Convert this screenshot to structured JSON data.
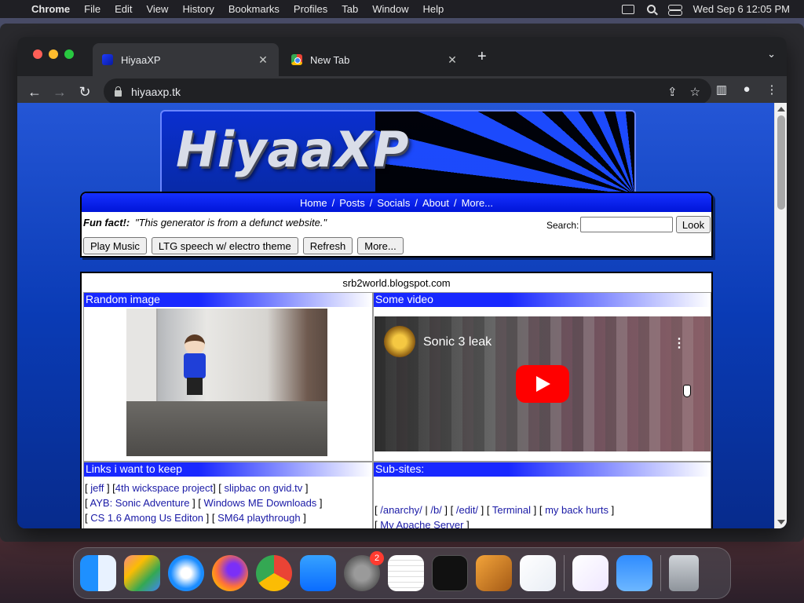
{
  "menubar": {
    "app_name": "Chrome",
    "items": [
      "File",
      "Edit",
      "View",
      "History",
      "Bookmarks",
      "Profiles",
      "Tab",
      "Window",
      "Help"
    ],
    "datetime": "Wed Sep 6  12:05 PM"
  },
  "browser": {
    "tabs": [
      {
        "title": "HiyaaXP",
        "active": true
      },
      {
        "title": "New Tab",
        "active": false
      }
    ],
    "url": "hiyaaxp.tk"
  },
  "page": {
    "banner_text": "HiyaaXP",
    "nav": [
      "Home",
      "Posts",
      "Socials",
      "About",
      "More..."
    ],
    "fun_fact_label": "Fun fact!:",
    "fun_fact_text": "\"This generator is from a defunct website.\"",
    "search_label": "Search:",
    "search_button": "Look",
    "buttons": [
      "Play Music",
      "LTG speech w/ electro theme",
      "Refresh",
      "More..."
    ],
    "site_title": "srb2world.blogspot.com",
    "sections": {
      "random_image": "Random image",
      "some_video": "Some video",
      "links": "Links i want to keep",
      "subsites": "Sub-sites:"
    },
    "video_title": "Sonic 3 leak",
    "links": [
      [
        "jeff",
        "4th wickspace project",
        "slipbac on gvid.tv"
      ],
      [
        "AYB: Sonic Adventure",
        "Windows ME Downloads"
      ],
      [
        "CS 1.6 Among Us Editon",
        "SM64 playthrough"
      ]
    ],
    "subsites": [
      [
        "/anarchy/",
        "/b/",
        "/edit/",
        "Terminal",
        "my back hurts"
      ],
      [
        "My Apache Server"
      ]
    ]
  },
  "dock": {
    "apps": [
      "Finder",
      "Launchpad",
      "Safari",
      "Firefox",
      "Chrome",
      "App Store",
      "System Settings",
      "TextEdit",
      "Terminal",
      "GarageBand",
      "VS Code",
      "Visual Studio",
      "Weather",
      "Trash"
    ],
    "settings_badge": "2"
  },
  "colors": {
    "page_bg": "#0a3bb5",
    "nav_blue": "#1530ff",
    "link": "#1a1aa6",
    "youtube_red": "#ff0000"
  }
}
